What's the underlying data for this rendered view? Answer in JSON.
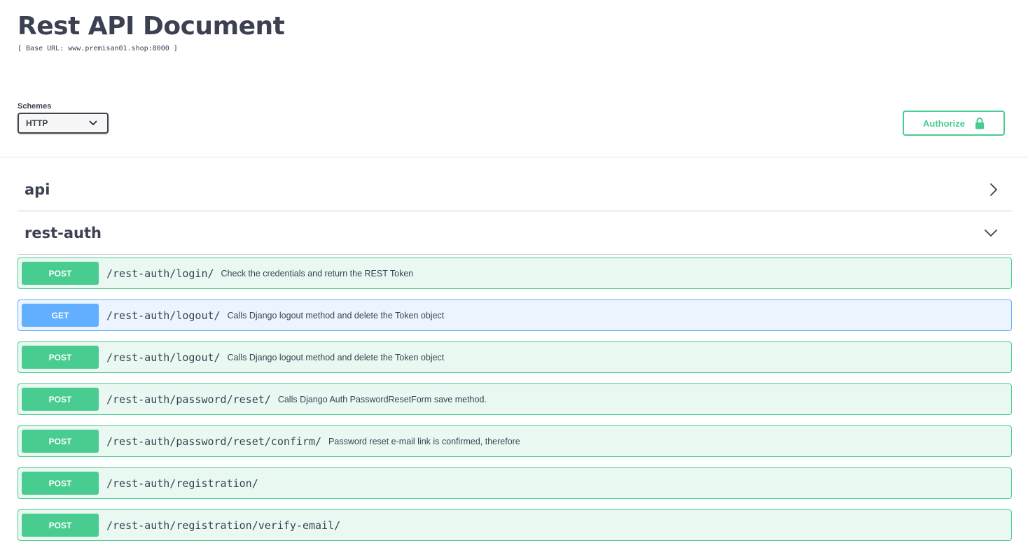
{
  "page": {
    "title": "Rest API Document",
    "base_url": "[ Base URL: www.premisan01.shop:8000 ]"
  },
  "schemes": {
    "label": "Schemes",
    "selected": "HTTP"
  },
  "authorize": {
    "label": "Authorize",
    "icon": "lock-icon"
  },
  "tags": [
    {
      "name": "api",
      "state": "collapsed",
      "icon": "chevron-right-icon"
    },
    {
      "name": "rest-auth",
      "state": "expanded",
      "icon": "chevron-down-icon"
    }
  ],
  "operations": [
    {
      "method": "POST",
      "path": "/rest-auth/login/",
      "summary": "Check the credentials and return the REST Token"
    },
    {
      "method": "GET",
      "path": "/rest-auth/logout/",
      "summary": "Calls Django logout method and delete the Token object"
    },
    {
      "method": "POST",
      "path": "/rest-auth/logout/",
      "summary": "Calls Django logout method and delete the Token object"
    },
    {
      "method": "POST",
      "path": "/rest-auth/password/reset/",
      "summary": "Calls Django Auth PasswordResetForm save method."
    },
    {
      "method": "POST",
      "path": "/rest-auth/password/reset/confirm/",
      "summary": "Password reset e-mail link is confirmed, therefore"
    },
    {
      "method": "POST",
      "path": "/rest-auth/registration/",
      "summary": ""
    },
    {
      "method": "POST",
      "path": "/rest-auth/registration/verify-email/",
      "summary": ""
    }
  ],
  "colors": {
    "post": "#49cc90",
    "get": "#61affe",
    "text": "#3b4151"
  }
}
